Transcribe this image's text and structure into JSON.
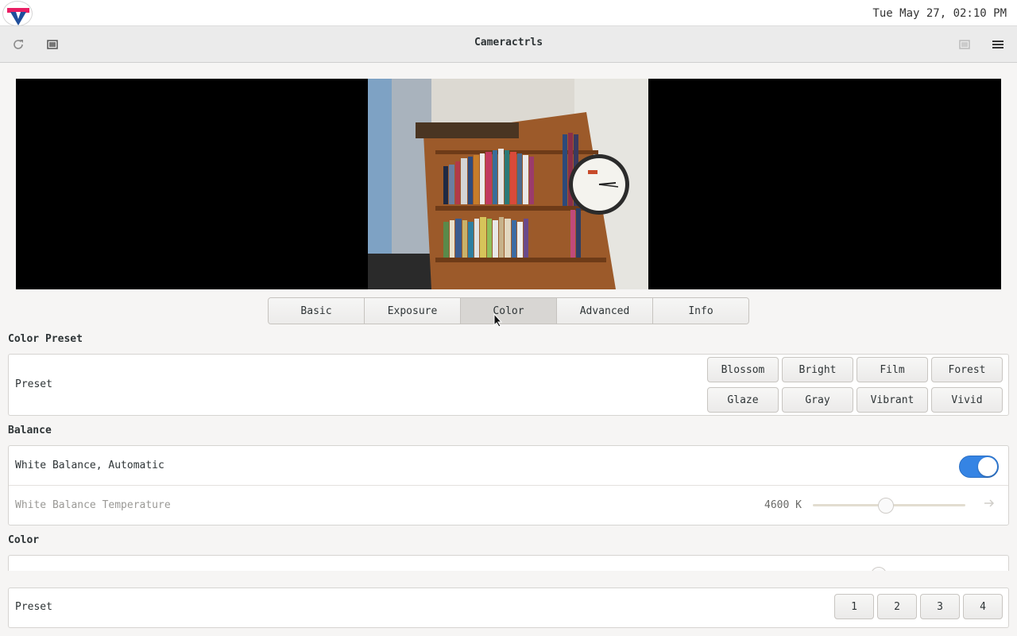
{
  "system": {
    "clock": "Tue May 27, 02:10 PM"
  },
  "header": {
    "title": "Cameractrls"
  },
  "tabs": [
    {
      "label": "Basic"
    },
    {
      "label": "Exposure"
    },
    {
      "label": "Color",
      "active": true
    },
    {
      "label": "Advanced"
    },
    {
      "label": "Info"
    }
  ],
  "color_preset": {
    "section_title": "Color Preset",
    "row_label": "Preset",
    "buttons": [
      "Blossom",
      "Bright",
      "Film",
      "Forest",
      "Glaze",
      "Gray",
      "Vibrant",
      "Vivid"
    ]
  },
  "balance": {
    "section_title": "Balance",
    "wb_auto_label": "White Balance, Automatic",
    "wb_auto_on": true,
    "wb_temp_label": "White Balance Temperature",
    "wb_temp_value": "4600 K",
    "wb_temp_fraction": 0.48
  },
  "color": {
    "section_title": "Color"
  },
  "bottom_preset": {
    "row_label": "Preset",
    "buttons": [
      "1",
      "2",
      "3",
      "4"
    ]
  },
  "colors": {
    "accent": "#3584e4",
    "window_bg": "#f6f5f4",
    "header_bg": "#ebebeb"
  },
  "icons": [
    "app-logo-icon",
    "refresh-icon",
    "screenshot-icon",
    "pip-icon",
    "menu-icon",
    "reset-arrow-icon",
    "mouse-cursor-icon"
  ]
}
